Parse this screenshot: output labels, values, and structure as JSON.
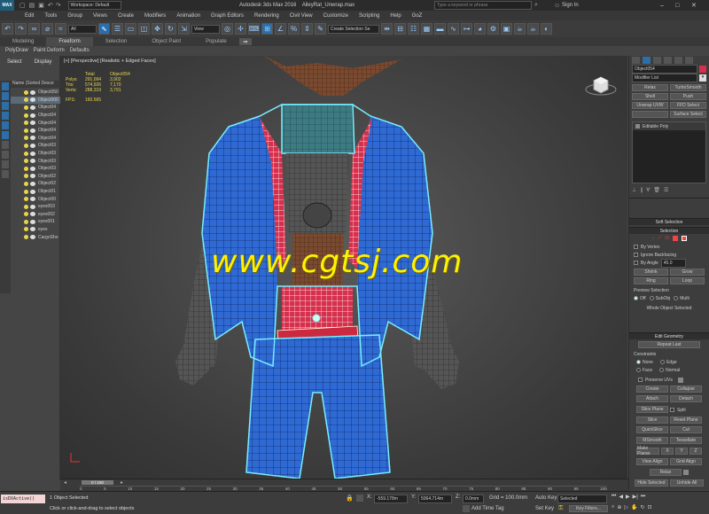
{
  "title": "Autodesk 3ds Max 2016    AlleyRat_Unwrap.max",
  "workspace": "Workspace: Default",
  "search_placeholder": "Type a keyword or phrase",
  "sign_in": "Sign In",
  "menu": [
    "Edit",
    "Tools",
    "Group",
    "Views",
    "Create",
    "Modifiers",
    "Animation",
    "Graph Editors",
    "Rendering",
    "Civil View",
    "Customize",
    "Scripting",
    "Help",
    "GoZ"
  ],
  "toolbar": {
    "selection_filter": "All",
    "ref_coord": "View",
    "named_selection": "Create Selection Se"
  },
  "ribbon_tabs": [
    "Modeling",
    "Freeform",
    "Selection",
    "Object Paint",
    "Populate"
  ],
  "ribbon_sub": [
    "PolyDraw",
    "Paint Deform",
    "Defaults"
  ],
  "scene": {
    "tabs": [
      "Select",
      "Display"
    ],
    "header": "Name (Sorted Desce",
    "items": [
      "Object050",
      "Object000",
      "Object04",
      "Object04",
      "Object04",
      "Object04",
      "Object04",
      "Object03",
      "Object03",
      "Object03",
      "Object03",
      "Object02",
      "Object02",
      "Object01",
      "Object00",
      "eyes003",
      "eyes002",
      "eyes001",
      "eyes",
      "CargoSho"
    ]
  },
  "viewport": {
    "label": "[+] [Perspective] [Realistic + Edged Faces]",
    "stats": {
      "col_total": "Total",
      "col_object": "Object054",
      "rows": [
        {
          "label": "Polys:",
          "total": "291,094",
          "object": "3,902"
        },
        {
          "label": "Tris:",
          "total": "574,926",
          "object": "7,170"
        },
        {
          "label": "Verts:",
          "total": "288,319",
          "object": "3,791"
        }
      ],
      "fps_label": "FPS:",
      "fps": "160.565"
    },
    "watermark": "www.cgtsj.com"
  },
  "modifier": {
    "object_name": "Object054",
    "list_label": "Modifier List",
    "buttons": [
      [
        "Relax",
        "TurboSmooth"
      ],
      [
        "Shell",
        "Push"
      ],
      [
        "Unwrap UVW",
        "FFD Select"
      ],
      [
        "",
        "Surface Select"
      ]
    ],
    "stack_item": "Editable Poly",
    "soft_selection": "Soft Selection",
    "selection": "Selection",
    "by_vertex": "By Vertex",
    "ignore_backfacing": "Ignore Backfacing",
    "by_angle": "By Angle",
    "angle_value": "45.0",
    "shrink": "Shrink",
    "grow": "Grow",
    "ring": "Ring",
    "loop": "Loop",
    "preview_selection": "Preview Selection",
    "preview_opts": [
      "Off",
      "SubObj",
      "Multi"
    ],
    "whole_object": "Whole Object Selected",
    "edit_geometry": "Edit Geometry",
    "repeat_last": "Repeat Last",
    "constraints": "Constraints",
    "constraint_opts": [
      "None",
      "Edge",
      "Face",
      "Normal"
    ],
    "preserve_uvs": "Preserve UVs",
    "create": "Create",
    "collapse": "Collapse",
    "attach": "Attach",
    "detach": "Detach",
    "slice_plane": "Slice Plane",
    "split": "Split",
    "slice": "Slice",
    "reset_plane": "Reset Plane",
    "quickslice": "QuickSlice",
    "cut": "Cut",
    "msmooth": "MSmooth",
    "tessellate": "Tessellate",
    "make_planar": "Make Planar",
    "xyz": [
      "X",
      "Y",
      "Z"
    ],
    "view_align": "View Align",
    "grid_align": "Grid Align",
    "relax": "Relax",
    "hide_selected": "Hide Selected",
    "unhide_all": "Unhide All"
  },
  "timeline": {
    "frame": "0 / 100",
    "ticks": [
      "0",
      "5",
      "10",
      "15",
      "20",
      "25",
      "30",
      "35",
      "40",
      "45",
      "50",
      "55",
      "60",
      "65",
      "70",
      "75",
      "80",
      "85",
      "90",
      "95",
      "100"
    ]
  },
  "status": {
    "maxscript": "isDXActive()",
    "selected": "1 Object Selected",
    "prompt": "Click or click-and-drag to select objects",
    "x": "-559.178m",
    "y": "5064.714m",
    "z": "0.0mm",
    "grid": "Grid = 100.0mm",
    "auto_key": "Auto Key",
    "selected_dd": "Selected",
    "set_key": "Set Key",
    "key_filters": "Key Filters...",
    "add_time_tag": "Add Time Tag"
  }
}
